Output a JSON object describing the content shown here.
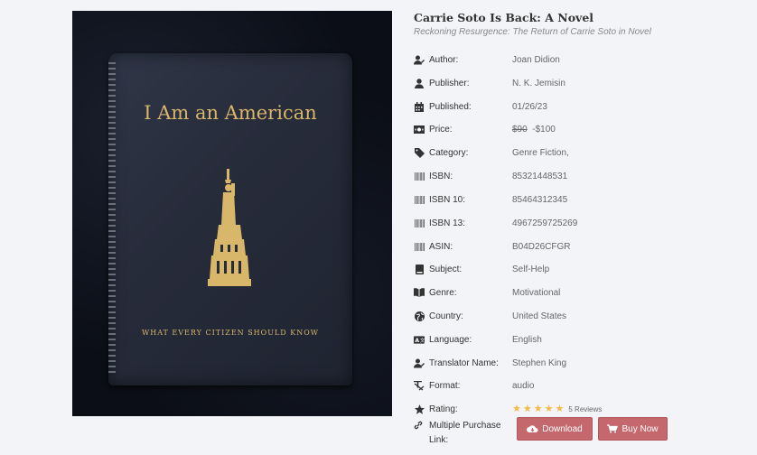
{
  "book": {
    "title": "Carrie Soto Is Back: A Novel",
    "subtitle": "Reckoning Resurgence: The Return of Carrie Soto in Novel",
    "cover": {
      "title": "I Am an American",
      "tagline": "WHAT EVERY CITIZEN SHOULD KNOW"
    }
  },
  "details": [
    {
      "icon": "user-edit-icon",
      "label": "Author:",
      "value": "Joan Didion"
    },
    {
      "icon": "user-icon",
      "label": "Publisher:",
      "value": "N. K. Jemisin"
    },
    {
      "icon": "calendar-icon",
      "label": "Published:",
      "value": "01/26/23"
    },
    {
      "icon": "money-icon",
      "label": "Price:",
      "value": ""
    },
    {
      "icon": "tag-icon",
      "label": "Category:",
      "value": "Genre Fiction,"
    },
    {
      "icon": "barcode-icon",
      "label": "ISBN:",
      "value": "85321448531"
    },
    {
      "icon": "barcode-icon",
      "label": "ISBN 10:",
      "value": "85464312345"
    },
    {
      "icon": "barcode-icon",
      "label": "ISBN 13:",
      "value": "4967259725269"
    },
    {
      "icon": "barcode-icon",
      "label": "ASIN:",
      "value": "B04D26CFGR"
    },
    {
      "icon": "book-icon",
      "label": "Subject:",
      "value": "Self-Help"
    },
    {
      "icon": "open-book-icon",
      "label": "Genre:",
      "value": "Motivational"
    },
    {
      "icon": "globe-icon",
      "label": "Country:",
      "value": "United States"
    },
    {
      "icon": "language-icon",
      "label": "Language:",
      "value": "English"
    },
    {
      "icon": "user-edit-icon",
      "label": "Translator Name:",
      "value": "Stephen King"
    },
    {
      "icon": "text-format-icon",
      "label": "Format:",
      "value": "audio"
    },
    {
      "icon": "star-icon",
      "label": "Rating:",
      "value": ""
    }
  ],
  "price": {
    "old": "$90",
    "current": "-$100"
  },
  "rating": {
    "stars": 5,
    "reviews": "5 Reviews"
  },
  "purchase": {
    "label_line1": "Multiple Purchase",
    "label_line2": "Link:",
    "download_label": "Download",
    "buy_label": "Buy Now"
  },
  "colors": {
    "accent": "#c5686e",
    "star": "#f4b942"
  }
}
